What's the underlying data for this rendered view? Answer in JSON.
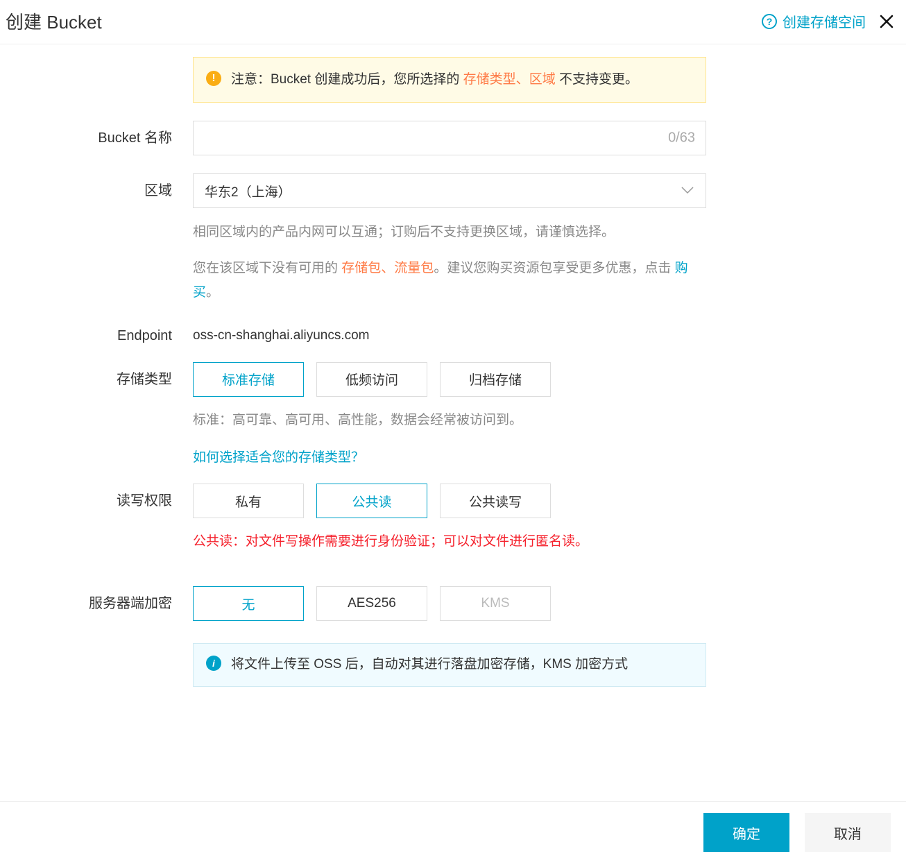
{
  "header": {
    "title": "创建 Bucket",
    "help_link": "创建存储空间"
  },
  "warning": {
    "prefix": "注意：Bucket 创建成功后，您所选择的 ",
    "hl1": "存储类型",
    "sep": "、",
    "hl2": "区域",
    "suffix": " 不支持变更。"
  },
  "labels": {
    "bucket_name": "Bucket 名称",
    "region": "区域",
    "endpoint": "Endpoint",
    "storage_type": "存储类型",
    "acl": "读写权限",
    "encryption": "服务器端加密"
  },
  "bucket_name": {
    "value": "",
    "count": "0/63"
  },
  "region": {
    "selected": "华东2（上海）",
    "hint1": "相同区域内的产品内网可以互通；订购后不支持更换区域，请谨慎选择。",
    "hint2_prefix": "您在该区域下没有可用的 ",
    "hint2_hl1": "存储包",
    "hint2_sep": "、",
    "hint2_hl2": "流量包",
    "hint2_mid": "。建议您购买资源包享受更多优惠，点击 ",
    "hint2_link": "购买",
    "hint2_suffix": "。"
  },
  "endpoint": {
    "value": "oss-cn-shanghai.aliyuncs.com"
  },
  "storage_type": {
    "options": [
      "标准存储",
      "低频访问",
      "归档存储"
    ],
    "desc": "标准：高可靠、高可用、高性能，数据会经常被访问到。",
    "help_link": "如何选择适合您的存储类型？"
  },
  "acl": {
    "options": [
      "私有",
      "公共读",
      "公共读写"
    ],
    "desc": "公共读：对文件写操作需要进行身份验证；可以对文件进行匿名读。"
  },
  "encryption": {
    "options": [
      "无",
      "AES256",
      "KMS"
    ],
    "info": "将文件上传至 OSS 后，自动对其进行落盘加密存储，KMS 加密方式"
  },
  "footer": {
    "confirm": "确定",
    "cancel": "取消"
  }
}
